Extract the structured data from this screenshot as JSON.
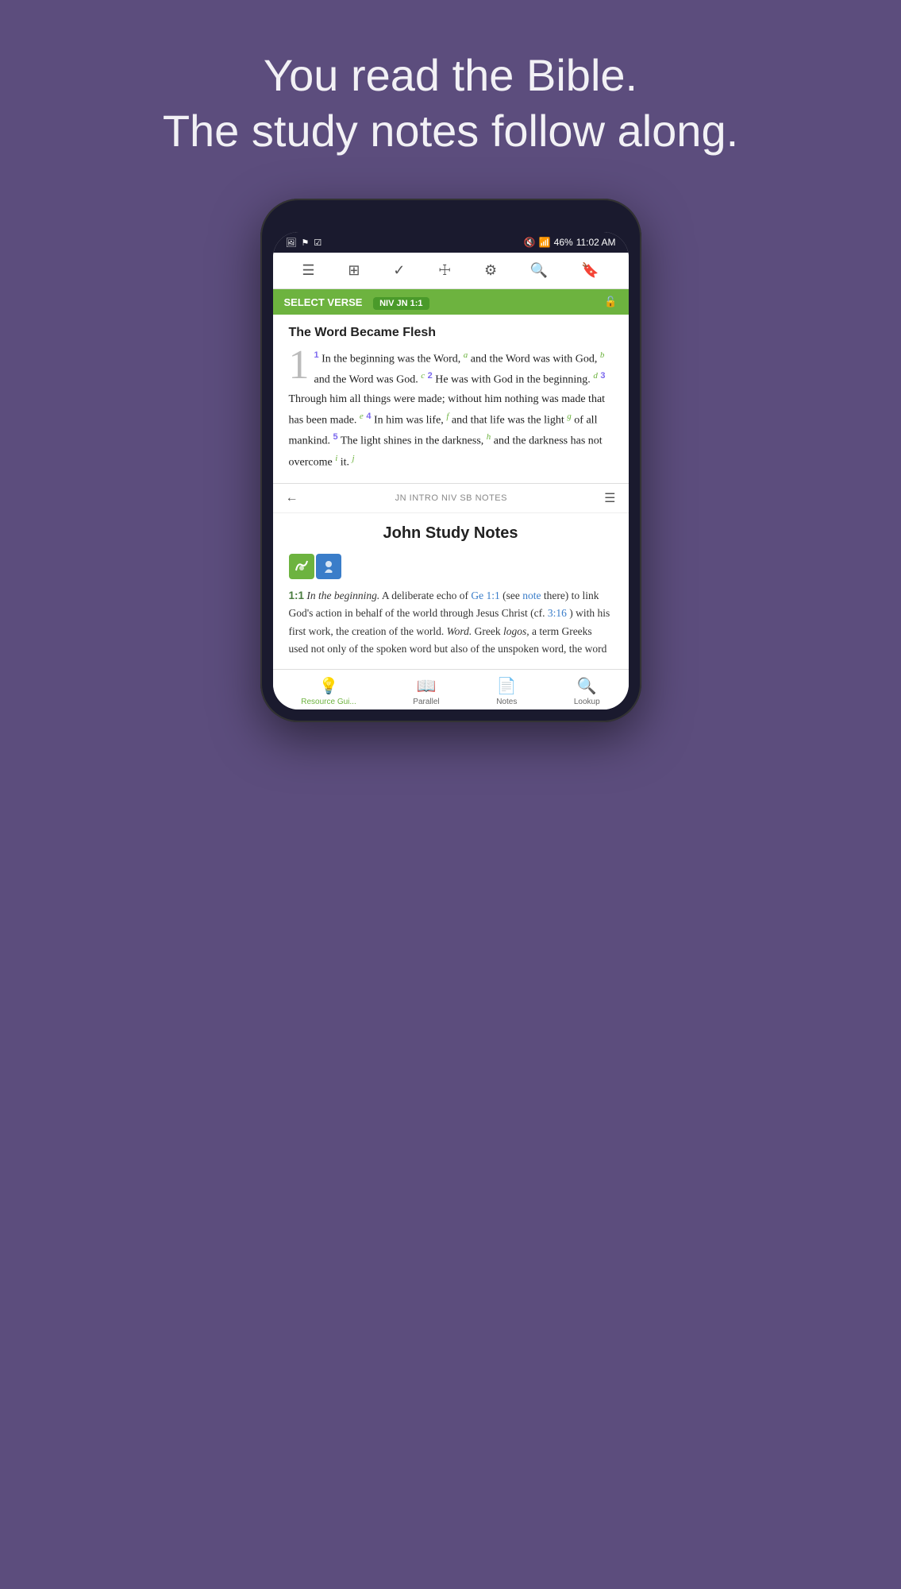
{
  "hero": {
    "line1": "You read the Bible.",
    "line2": "The study notes follow along."
  },
  "status_bar": {
    "left_icons": [
      "img-icon",
      "flag-icon",
      "check-icon"
    ],
    "time": "11:02 AM",
    "battery": "46%",
    "signal": "▲▲▲"
  },
  "toolbar": {
    "icons": [
      "≡",
      "⊞",
      "✓",
      "🛒",
      "⚙",
      "🔍",
      "🔖"
    ]
  },
  "select_verse_bar": {
    "label": "SELECT VERSE",
    "badge": "NIV JN 1:1",
    "lock_icon": "🔓"
  },
  "bible": {
    "section_title": "The Word Became Flesh",
    "large_number": "1",
    "content": "In the beginning was the Word,",
    "full_text": "In the beginning was the Word, and the Word was with God, and the Word was God. He was with God in the beginning. Through him all things were made; without him nothing was made that has been made. In him was life, and that life was the light of all mankind. The light shines in the darkness, and the darkness has not overcome it.",
    "nav_label": "JN INTRO NIV SB NOTES"
  },
  "study_notes": {
    "title": "John Study Notes",
    "ref": "1:1",
    "ref_text": "In the beginning.",
    "body_start": "A deliberate echo of",
    "link1": "Ge 1:1",
    "link1_text": "(see",
    "link2": "note",
    "body2": "there) to link God's action in behalf of the world through Jesus Christ (cf.",
    "link3": "3:16",
    "body3": ") with his first work, the creation of the world.",
    "word_label": "Word.",
    "word_text": "Greek",
    "logos_italic": "logos,",
    "body4": "a term Greeks used not only of the spoken word but also of the unspoken word, the word"
  },
  "bottom_tabs": [
    {
      "icon": "💡",
      "label": "Resource Gui...",
      "active": true
    },
    {
      "icon": "📖",
      "label": "Parallel",
      "active": false
    },
    {
      "icon": "📄",
      "label": "Notes",
      "active": false
    },
    {
      "icon": "🔍",
      "label": "Lookup",
      "active": false
    }
  ]
}
